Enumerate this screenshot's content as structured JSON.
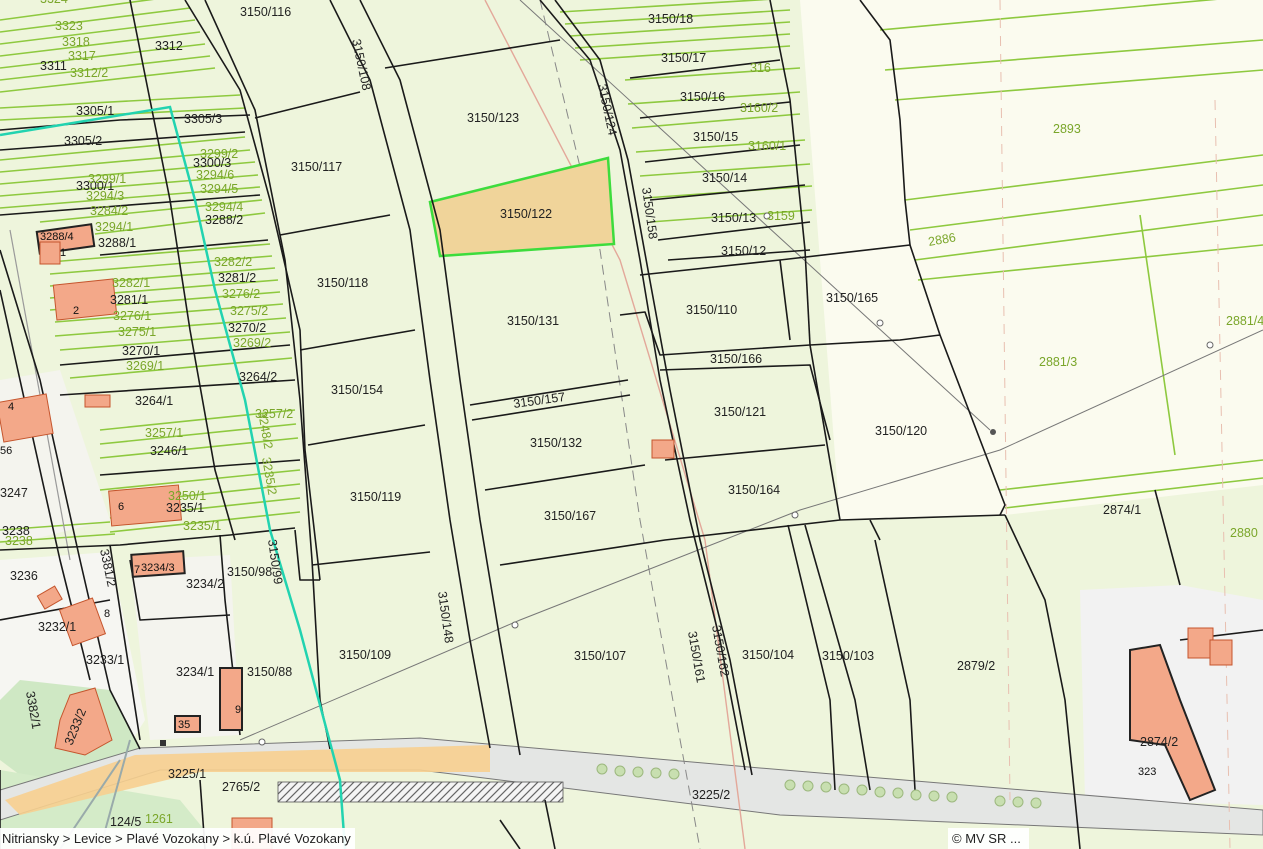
{
  "breadcrumb": [
    "Nitriansky",
    "Levice",
    "Plavé Vozokany",
    "k.ú. Plavé Vozokany"
  ],
  "breadcrumb_separator": " > ",
  "attribution": "© MV SR ...",
  "highlighted_parcel": "3150/122",
  "colors": {
    "background": "#eef5dc",
    "parcel_border": "#1a1a1a",
    "highlight_fill": "#f0d49a",
    "highlight_border": "#3ddc3d",
    "cadastral_boundary": "#22d3b0",
    "building": "#f3a889",
    "road": "#e4e6e4",
    "green_label": "#7aa62a"
  },
  "parcels": [
    "3150/116",
    "3150/108",
    "3150/123",
    "3150/124",
    "3150/18",
    "3150/17",
    "3150/16",
    "3150/15",
    "3150/14",
    "3150/13",
    "3150/12",
    "3150/158",
    "3150/117",
    "3150/122",
    "3150/118",
    "3150/131",
    "3150/110",
    "3150/165",
    "3150/166",
    "3150/154",
    "3150/157",
    "3150/132",
    "3150/121",
    "3150/120",
    "3150/119",
    "3150/167",
    "3150/164",
    "3150/98",
    "3150/99",
    "3150/109",
    "3150/148",
    "3150/107",
    "3150/161",
    "3150/162",
    "3150/104",
    "3150/103",
    "3150/88",
    "3225/1",
    "3225/2",
    "2765/2",
    "2893",
    "2886",
    "2881/3",
    "2874/1",
    "2879/2",
    "2874/2",
    "3312",
    "3311",
    "3305/1",
    "3305/3",
    "3305/2",
    "3300/3",
    "3300/1",
    "3288/4",
    "3288/2",
    "3288/1",
    "3281/2",
    "3281/1",
    "3270/2",
    "3270/1",
    "3264/2",
    "3264/1",
    "3246/1",
    "3235/1",
    "3234/3",
    "3234/2",
    "3232/1",
    "3236",
    "3238",
    "3247",
    "3233/1",
    "3234/1",
    "3381/2",
    "3382/1",
    "3233/2",
    "124/5",
    "323"
  ],
  "green_labels": [
    "3324",
    "3323",
    "3318",
    "3317",
    "3312/2",
    "3299/2",
    "3294/6",
    "3299/1",
    "3294/3",
    "3294/5",
    "3294/4",
    "3284/2",
    "3294/1",
    "3282/2",
    "3282/1",
    "3276/2",
    "3276/1",
    "3275/2",
    "3275/1",
    "3269/2",
    "3269/1",
    "3257/2",
    "3257/1",
    "3248/2",
    "3235/2",
    "3250/1",
    "3235/1",
    "3159",
    "3160/1",
    "3160/2",
    "316",
    "2881/4",
    "2880",
    "1261",
    "2893",
    "2886",
    "2881/3",
    "2880",
    "3238"
  ],
  "building_numbers": [
    "1",
    "2",
    "4",
    "56",
    "6",
    "7",
    "8",
    "9",
    "35"
  ]
}
